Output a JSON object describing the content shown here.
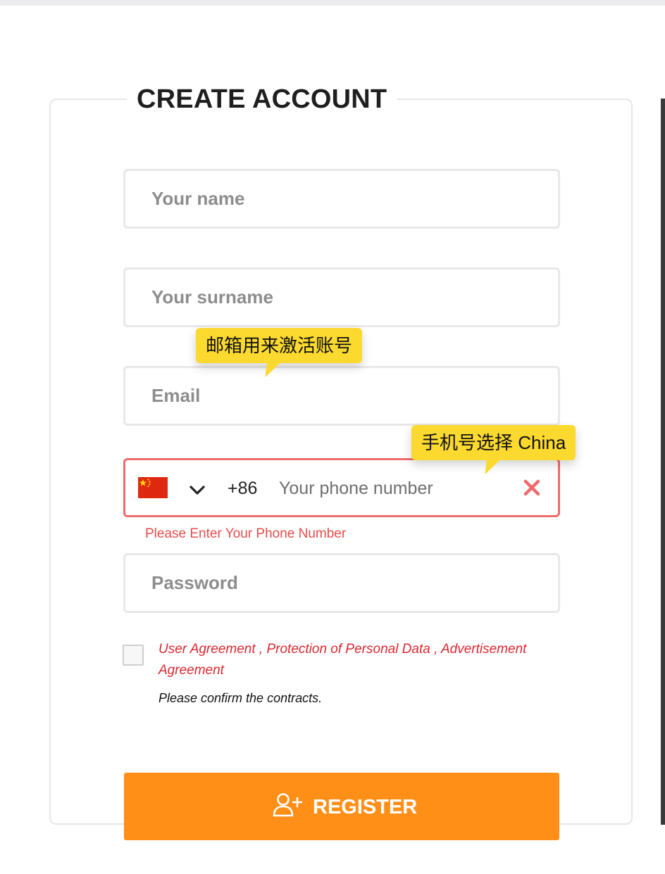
{
  "form": {
    "title": "CREATE ACCOUNT",
    "name_placeholder": "Your name",
    "surname_placeholder": "Your surname",
    "email_placeholder": "Email",
    "phone": {
      "country": "China",
      "flag_icon": "china-flag-icon",
      "dial_code": "+86",
      "placeholder": "Your phone number",
      "error": "Please Enter Your Phone Number",
      "error_color": "#e74c4c"
    },
    "password_placeholder": "Password",
    "agreements": {
      "user_agreement": "User Agreement",
      "sep1": " , ",
      "personal_data": "Protection of Personal Data",
      "sep2": " , ",
      "advertisement": "Advertisement Agreement",
      "confirm_text": "Please confirm the contracts.",
      "link_color": "#d9282f"
    },
    "register_label": "REGISTER",
    "register_color": "#ff8f17"
  },
  "tooltips": {
    "email": "邮箱用来激活账号",
    "phone": "手机号选择 China",
    "color": "#fbd92f"
  }
}
